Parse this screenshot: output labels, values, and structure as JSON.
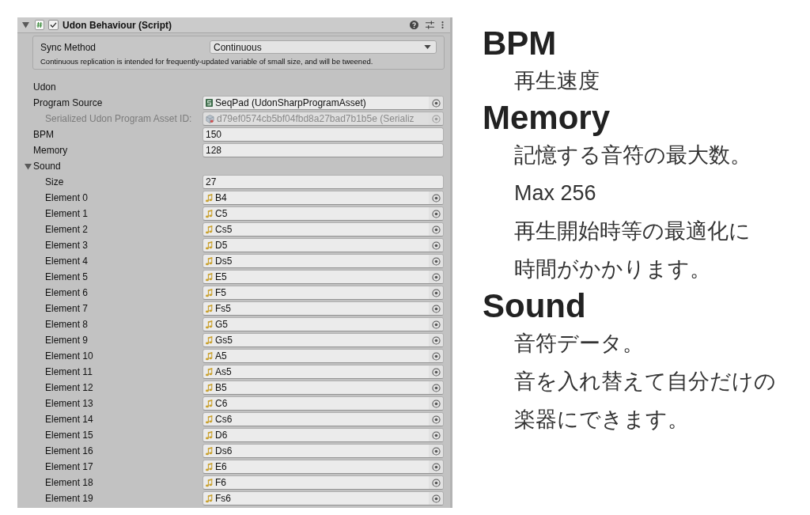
{
  "component": {
    "title": "Udon Behaviour (Script)",
    "expanded": true,
    "enabled": true
  },
  "sync": {
    "label": "Sync Method",
    "value": "Continuous",
    "note": "Continuous replication is intended for frequently-updated variable of small size, and will be tweened."
  },
  "properties": [
    {
      "kind": "heading",
      "label": "Udon"
    },
    {
      "kind": "script",
      "label": "Program Source",
      "value": "SeqPad (UdonSharpProgramAsset)",
      "disabled": false
    },
    {
      "kind": "serialized",
      "label": "Serialized Udon Program Asset ID:",
      "value": "d79ef0574cb5bf04fbd8a27bad7b1b5e (Serializ",
      "disabled": true
    },
    {
      "kind": "number",
      "label": "BPM",
      "value": "150"
    },
    {
      "kind": "number",
      "label": "Memory",
      "value": "128"
    },
    {
      "kind": "array",
      "label": "Sound",
      "expanded": true,
      "size_label": "Size",
      "size": "27",
      "children": [
        {
          "label": "Element 0",
          "value": "B4"
        },
        {
          "label": "Element 1",
          "value": "C5"
        },
        {
          "label": "Element 2",
          "value": "Cs5"
        },
        {
          "label": "Element 3",
          "value": "D5"
        },
        {
          "label": "Element 4",
          "value": "Ds5"
        },
        {
          "label": "Element 5",
          "value": "E5"
        },
        {
          "label": "Element 6",
          "value": "F5"
        },
        {
          "label": "Element 7",
          "value": "Fs5"
        },
        {
          "label": "Element 8",
          "value": "G5"
        },
        {
          "label": "Element 9",
          "value": "Gs5"
        },
        {
          "label": "Element 10",
          "value": "A5"
        },
        {
          "label": "Element 11",
          "value": "As5"
        },
        {
          "label": "Element 12",
          "value": "B5"
        },
        {
          "label": "Element 13",
          "value": "C6"
        },
        {
          "label": "Element 14",
          "value": "Cs6"
        },
        {
          "label": "Element 15",
          "value": "D6"
        },
        {
          "label": "Element 16",
          "value": "Ds6"
        },
        {
          "label": "Element 17",
          "value": "E6"
        },
        {
          "label": "Element 18",
          "value": "F6"
        },
        {
          "label": "Element 19",
          "value": "Fs6"
        }
      ]
    }
  ],
  "notes": [
    {
      "kind": "heading",
      "text": "BPM"
    },
    {
      "kind": "body",
      "text": "再生速度"
    },
    {
      "kind": "heading",
      "text": "Memory"
    },
    {
      "kind": "body",
      "text": "記憶する音符の最大数。"
    },
    {
      "kind": "body",
      "text": "Max 256"
    },
    {
      "kind": "body",
      "text": "再生開始時等の最適化に"
    },
    {
      "kind": "body",
      "text": "時間がかかります。"
    },
    {
      "kind": "heading",
      "text": "Sound"
    },
    {
      "kind": "body",
      "text": "音符データ。"
    },
    {
      "kind": "body",
      "text": "音を入れ替えて自分だけの"
    },
    {
      "kind": "body",
      "text": "楽器にできます。"
    }
  ]
}
